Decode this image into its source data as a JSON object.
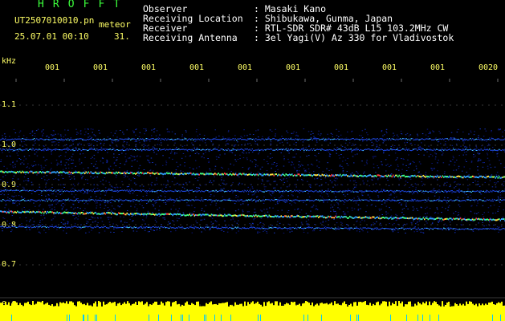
{
  "header": {
    "title": "HROFFT",
    "file_name": "UT2507010010.pn",
    "suffix": "meteor",
    "datetime": "25.07.01 00:10",
    "count": "31."
  },
  "meta": [
    {
      "label": "Observer",
      "value": ": Masaki Kano"
    },
    {
      "label": "Receiving Location",
      "value": ": Shibukawa, Gunma, Japan"
    },
    {
      "label": "Receiver",
      "value": ": RTL-SDR SDR# 43dB L15 103.2MHz CW"
    },
    {
      "label": "Receiving Antenna",
      "value": ": 3el Yagi(V) Az 330 for Vladivostok"
    }
  ],
  "axis": {
    "unit": "kHz",
    "frequency_ticks": [
      "1.1",
      "1.0",
      "0.9",
      "0.8",
      "0.7",
      "0.6"
    ],
    "time_ticks": [
      "001",
      "001",
      "001",
      "001",
      "001",
      "001",
      "001",
      "001",
      "001",
      "0020"
    ]
  },
  "colors": {
    "background": "#000000",
    "grid": "#707070",
    "label": "#ffff66",
    "title": "#3cff3c",
    "baseline": "#ffff00",
    "spike": "#00c8ff"
  }
}
